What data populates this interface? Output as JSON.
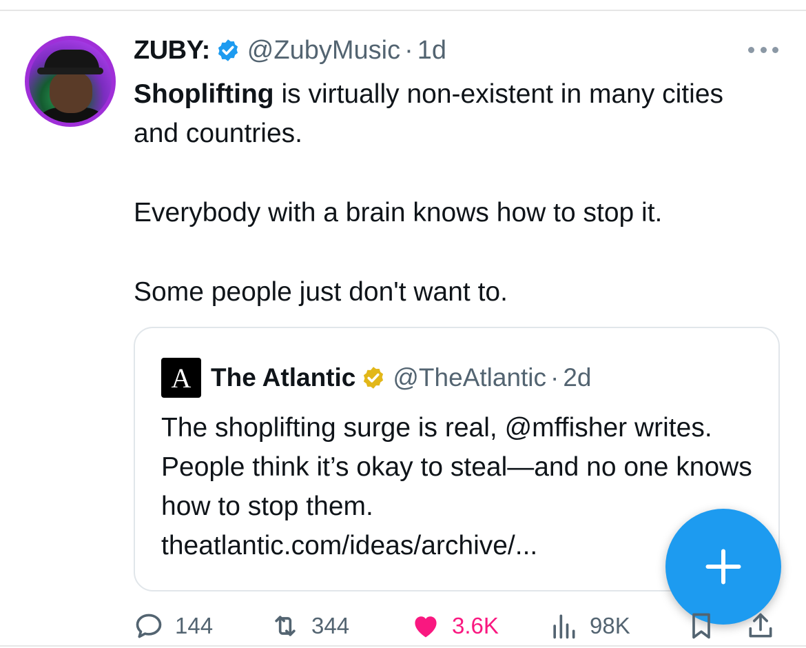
{
  "tweet": {
    "author": {
      "name": "ZUBY:",
      "handle": "@ZubyMusic",
      "time": "1d",
      "separator": "·"
    },
    "body": {
      "bold_lead": "Shoplifting",
      "line1_rest": " is virtually non-existent in many cities and countries.",
      "line2": "Everybody with a brain knows how to stop it.",
      "line3": "Some people just don't want to."
    },
    "quote": {
      "logo_letter": "A",
      "name": "The Atlantic",
      "handle": "@TheAtlantic",
      "time": "2d",
      "separator": "·",
      "text": "The shoplifting surge is real, @mffisher writes. People think it’s okay to steal—and no one knows how to stop them.",
      "link": "theatlantic.com/ideas/archive/..."
    },
    "stats": {
      "replies": "144",
      "retweets": "344",
      "likes": "3.6K",
      "views": "98K"
    }
  },
  "colors": {
    "accent": "#1d9bf0",
    "like": "#f91880",
    "muted": "#536471",
    "verified_blue": "#1d9bf0",
    "verified_gold": "#e2b719",
    "avatar_ring": "#9f2fd8"
  },
  "icons": {
    "more": "more-horizontal-icon",
    "verified": "verified-badge-icon",
    "verified_org": "verified-gold-badge-icon",
    "reply": "reply-icon",
    "retweet": "retweet-icon",
    "like": "heart-icon",
    "views": "views-chart-icon",
    "bookmark": "bookmark-icon",
    "share": "share-icon",
    "compose": "plus-icon"
  }
}
